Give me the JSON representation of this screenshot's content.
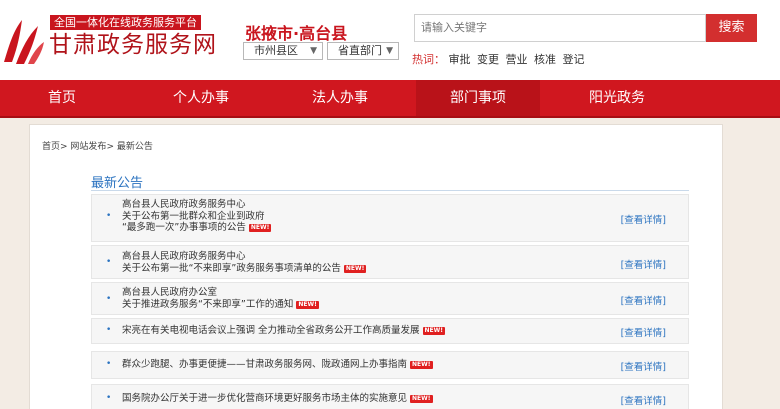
{
  "header": {
    "slogan": "全国一体化在线政务服务平台",
    "site_name": "甘肃政务服务网",
    "region_title": "张掖市·高台县",
    "select_city": "市州县区",
    "select_dept": "省直部门",
    "search_placeholder": "请输入关键字",
    "search_button": "搜索",
    "hot_label": "热词：",
    "hot_words": [
      "审批",
      "变更",
      "营业",
      "核准",
      "登记"
    ]
  },
  "nav": {
    "items": [
      "首页",
      "个人办事",
      "法人办事",
      "部门事项",
      "阳光政务"
    ],
    "active": "部门事项"
  },
  "breadcrumb": [
    "首页",
    "网站发布",
    "最新公告"
  ],
  "section_title": "最新公告",
  "new_badge": "NEW!",
  "detail_label": "[查看详情]",
  "notices": [
    {
      "lines": [
        "高台县人民政府政务服务中心",
        "关于公布第一批群众和企业到政府",
        "“最多跑一次”办事事项的公告"
      ]
    },
    {
      "lines": [
        "高台县人民政府政务服务中心",
        "关于公布第一批“不来即享”政务服务事项清单的公告"
      ]
    },
    {
      "lines": [
        "高台县人民政府办公室",
        "关于推进政务服务“不来即享”工作的通知"
      ]
    },
    {
      "lines": [
        "宋亮在有关电视电话会议上强调 全力推动全省政务公开工作高质量发展"
      ]
    },
    {
      "lines": [
        "群众少跑腿、办事更便捷——甘肃政务服务网、陇政通网上办事指南"
      ]
    },
    {
      "lines": [
        "国务院办公厅关于进一步优化营商环境更好服务市场主体的实施意见"
      ]
    }
  ],
  "colors": {
    "brand_red": "#d0171f",
    "link_blue": "#2b73c0"
  }
}
